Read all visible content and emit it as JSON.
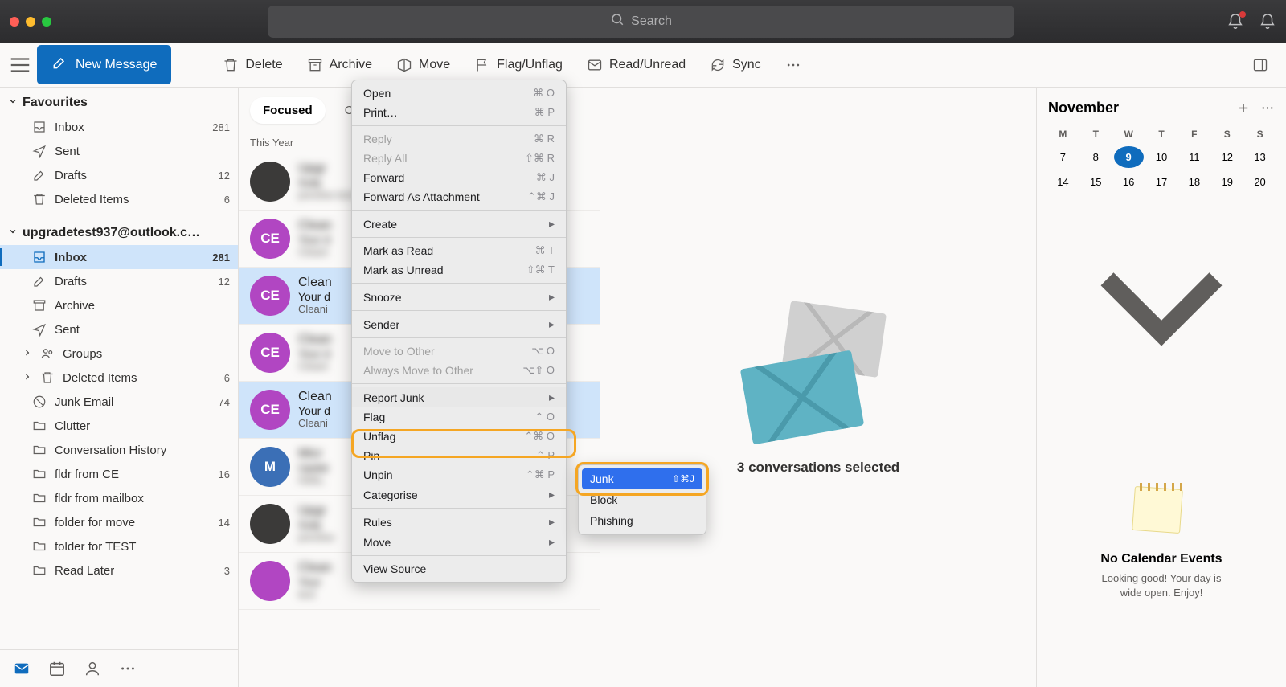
{
  "titlebar": {
    "search_placeholder": "Search"
  },
  "toolbar": {
    "new_message": "New Message",
    "delete": "Delete",
    "archive": "Archive",
    "move": "Move",
    "flag": "Flag/Unflag",
    "read": "Read/Unread",
    "sync": "Sync"
  },
  "sidebar": {
    "favourites_label": "Favourites",
    "account_label": "upgradetest937@outlook.c…",
    "fav": [
      {
        "label": "Inbox",
        "count": "281"
      },
      {
        "label": "Sent",
        "count": ""
      },
      {
        "label": "Drafts",
        "count": "12"
      },
      {
        "label": "Deleted Items",
        "count": "6"
      }
    ],
    "acct": [
      {
        "label": "Inbox",
        "count": "281"
      },
      {
        "label": "Drafts",
        "count": "12"
      },
      {
        "label": "Archive",
        "count": ""
      },
      {
        "label": "Sent",
        "count": ""
      },
      {
        "label": "Groups",
        "count": ""
      },
      {
        "label": "Deleted Items",
        "count": "6"
      },
      {
        "label": "Junk Email",
        "count": "74"
      },
      {
        "label": "Clutter",
        "count": ""
      },
      {
        "label": "Conversation History",
        "count": ""
      },
      {
        "label": "fldr from CE",
        "count": "16"
      },
      {
        "label": "fldr from mailbox",
        "count": ""
      },
      {
        "label": "folder for move",
        "count": "14"
      },
      {
        "label": "folder for TEST",
        "count": ""
      },
      {
        "label": "Read Later",
        "count": "3"
      }
    ]
  },
  "msglist": {
    "tab_focused": "Focused",
    "tab_other": "Oth",
    "section": "This Year",
    "items": [
      {
        "from": "Upgr",
        "subj": "Subj",
        "prev": "preview text line"
      },
      {
        "from": "Clean",
        "subj": "Your d",
        "prev": "Cleani"
      },
      {
        "from": "Clean",
        "subj": "Your d",
        "prev": "Cleani"
      },
      {
        "from": "Clean",
        "subj": "Your d",
        "prev": "Cleani"
      },
      {
        "from": "Clean",
        "subj": "Your d",
        "prev": "Cleani"
      },
      {
        "from": "Micr",
        "subj": "Updat",
        "prev": "Hello,"
      },
      {
        "from": "Upgr",
        "subj": "Subj",
        "prev": "preview"
      },
      {
        "from": "Clean",
        "subj": "Your",
        "prev": "text"
      }
    ],
    "avatars": [
      "",
      "CE",
      "CE",
      "CE",
      "CE",
      "M",
      "",
      ""
    ],
    "avatar_class": [
      "av-dark",
      "av-purple",
      "av-purple",
      "av-purple",
      "av-purple",
      "av-blue",
      "av-dark",
      "av-purple"
    ],
    "selected_idx": [
      2,
      4
    ]
  },
  "reading": {
    "text": "3 conversations selected"
  },
  "calendar": {
    "title": "November",
    "dow": [
      "M",
      "T",
      "W",
      "T",
      "F",
      "S",
      "S"
    ],
    "row1": [
      "7",
      "8",
      "9",
      "10",
      "11",
      "12",
      "13"
    ],
    "row2": [
      "14",
      "15",
      "16",
      "17",
      "18",
      "19",
      "20"
    ],
    "today_idx": 2,
    "empty_title": "No Calendar Events",
    "empty_text1": "Looking good! Your day is",
    "empty_text2": "wide open. Enjoy!"
  },
  "context_menu": {
    "open": {
      "label": "Open",
      "short": "⌘ O"
    },
    "print": {
      "label": "Print…",
      "short": "⌘ P"
    },
    "reply": {
      "label": "Reply",
      "short": "⌘ R"
    },
    "reply_all": {
      "label": "Reply All",
      "short": "⇧⌘ R"
    },
    "forward": {
      "label": "Forward",
      "short": "⌘ J"
    },
    "forward_att": {
      "label": "Forward As Attachment",
      "short": "⌃⌘ J"
    },
    "create": {
      "label": "Create"
    },
    "mark_read": {
      "label": "Mark as Read",
      "short": "⌘ T"
    },
    "mark_unread": {
      "label": "Mark as Unread",
      "short": "⇧⌘ T"
    },
    "snooze": {
      "label": "Snooze"
    },
    "sender": {
      "label": "Sender"
    },
    "move_other": {
      "label": "Move to Other",
      "short": "⌥ O"
    },
    "always_move": {
      "label": "Always Move to Other",
      "short": "⌥⇧ O"
    },
    "report_junk": {
      "label": "Report Junk"
    },
    "flag": {
      "label": "Flag",
      "short": "⌃ O"
    },
    "unflag": {
      "label": "Unflag",
      "short": "⌃⌘ O"
    },
    "pin": {
      "label": "Pin",
      "short": "⌃ P"
    },
    "unpin": {
      "label": "Unpin",
      "short": "⌃⌘ P"
    },
    "categorise": {
      "label": "Categorise"
    },
    "rules": {
      "label": "Rules"
    },
    "move": {
      "label": "Move"
    },
    "view_source": {
      "label": "View Source"
    }
  },
  "submenu": {
    "junk": {
      "label": "Junk",
      "short": "⇧⌘J"
    },
    "block": "Block",
    "phishing": "Phishing"
  }
}
